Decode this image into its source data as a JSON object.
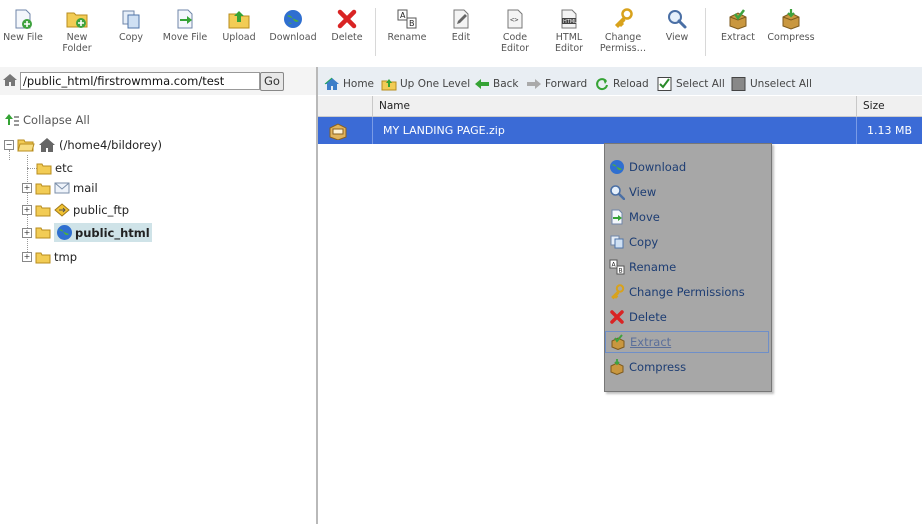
{
  "toolbar": {
    "items": [
      {
        "label": "New File",
        "icon": "new-file-icon"
      },
      {
        "label": "New\nFolder",
        "icon": "new-folder-icon"
      },
      {
        "label": "Copy",
        "icon": "copy-icon"
      },
      {
        "label": "Move File",
        "icon": "move-file-icon"
      },
      {
        "label": "Upload",
        "icon": "upload-icon"
      },
      {
        "label": "Download",
        "icon": "download-icon"
      },
      {
        "label": "Delete",
        "icon": "delete-icon"
      },
      {
        "label": "Rename",
        "icon": "rename-icon"
      },
      {
        "label": "Edit",
        "icon": "edit-icon"
      },
      {
        "label": "Code\nEditor",
        "icon": "code-editor-icon"
      },
      {
        "label": "HTML\nEditor",
        "icon": "html-editor-icon"
      },
      {
        "label": "Change\nPermiss…",
        "icon": "change-permissions-icon"
      },
      {
        "label": "View",
        "icon": "view-icon"
      },
      {
        "label": "Extract",
        "icon": "extract-icon"
      },
      {
        "label": "Compress",
        "icon": "compress-icon"
      }
    ]
  },
  "path": {
    "value": "/public_html/firstrowmma.com/test",
    "go_label": "Go"
  },
  "nav": {
    "home": "Home",
    "up": "Up One Level",
    "back": "Back",
    "forward": "Forward",
    "reload": "Reload",
    "select_all": "Select All",
    "unselect_all": "Unselect All"
  },
  "tree": {
    "collapse_all": "Collapse All",
    "root": "(/home4/bildorey)",
    "items": [
      "etc",
      "mail",
      "public_ftp",
      "public_html",
      "tmp"
    ]
  },
  "table": {
    "headers": [
      "Name",
      "Size"
    ],
    "rows": [
      {
        "name": "MY LANDING PAGE.zip",
        "size": "1.13 MB"
      }
    ]
  },
  "context_menu": {
    "items": [
      "Download",
      "View",
      "Move",
      "Copy",
      "Rename",
      "Change Permissions",
      "Delete",
      "Extract",
      "Compress"
    ]
  }
}
